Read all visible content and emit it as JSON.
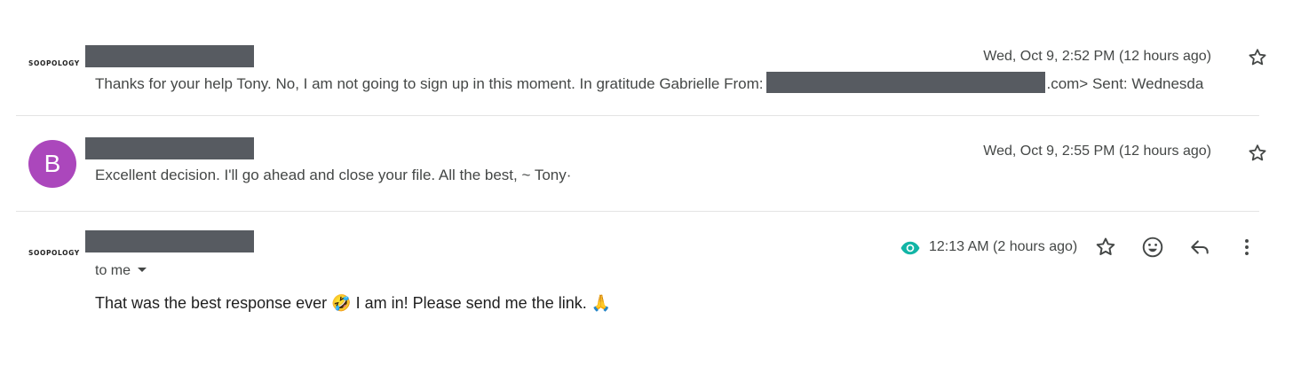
{
  "messages": [
    {
      "sender_logo_text": "SOOPOLOGY",
      "snippet_before": "Thanks for your help Tony. No, I am not going to sign up in this moment. In gratitude Gabrielle From:",
      "snippet_after": ".com> Sent: Wednesda",
      "date": "Wed, Oct 9, 2:52 PM (12 hours ago)",
      "starred": false
    },
    {
      "avatar_letter": "B",
      "avatar_color": "#ab47bc",
      "snippet": "Excellent decision. I'll go ahead and close your file. All the best, ~ Tony·",
      "date": "Wed, Oct 9, 2:55 PM (12 hours ago)",
      "starred": false
    },
    {
      "sender_logo_text": "SOOPOLOGY",
      "recipient_label": "to me",
      "body_before": "That was the best response ever",
      "emoji_laugh": "🤣",
      "body_middle": "I am in! Please send me the link.",
      "emoji_pray": "🙏",
      "time": "12:13 AM (2 hours ago)",
      "tracking_icon": "eye-icon",
      "tracking_color": "#12b5a6"
    }
  ],
  "actions": [
    "star-icon",
    "emoji-icon",
    "reply-icon",
    "more-vert-icon"
  ]
}
